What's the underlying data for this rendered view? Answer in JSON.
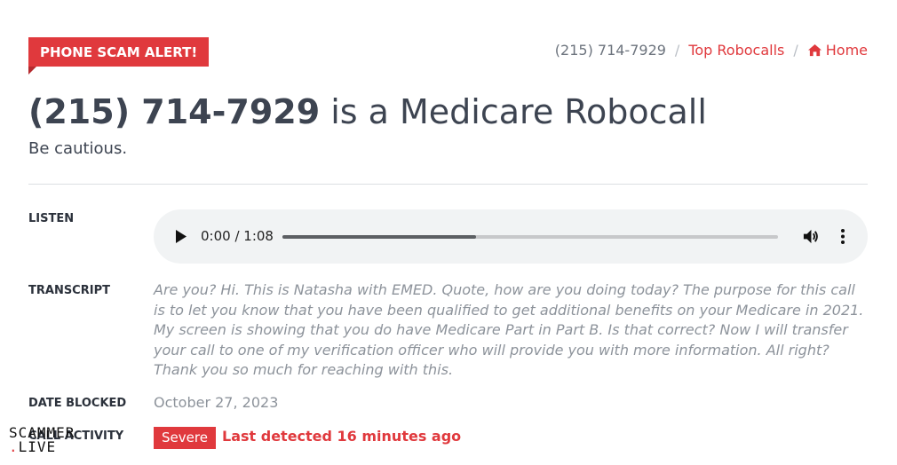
{
  "header": {
    "alert_badge": "PHONE SCAM ALERT!",
    "breadcrumb": {
      "phone": "(215) 714-7929",
      "separator": "/",
      "top_robocalls": "Top Robocalls",
      "home": "Home"
    }
  },
  "title": {
    "number": "(215) 714-7929",
    "rest": " is a Medicare Robocall"
  },
  "subtitle": "Be cautious.",
  "listen": {
    "label": "LISTEN",
    "time": "0:00 / 1:08",
    "progress": 0.39
  },
  "transcript": {
    "label": "TRANSCRIPT",
    "text": "Are you? Hi. This is Natasha with EMED. Quote, how are you doing today? The purpose for this call is to let you know that you have been qualified to get additional benefits on your Medicare in 2021. My screen is showing that you do have Medicare Part in Part B. Is that correct? Now I will transfer your call to one of my verification officer who will provide you with more information. All right? Thank you so much for reaching with this."
  },
  "date_blocked": {
    "label": "DATE BLOCKED",
    "value": "October 27, 2023"
  },
  "call_activity": {
    "label": "CALL ACTIVITY",
    "severity": "Severe",
    "last_detected": "Last detected 16 minutes ago"
  },
  "watermark": {
    "line1": "SCAMMER",
    "line2": "LIVE"
  },
  "colors": {
    "accent": "#e0393d",
    "text": "#3d4451",
    "muted": "#8d939b"
  }
}
